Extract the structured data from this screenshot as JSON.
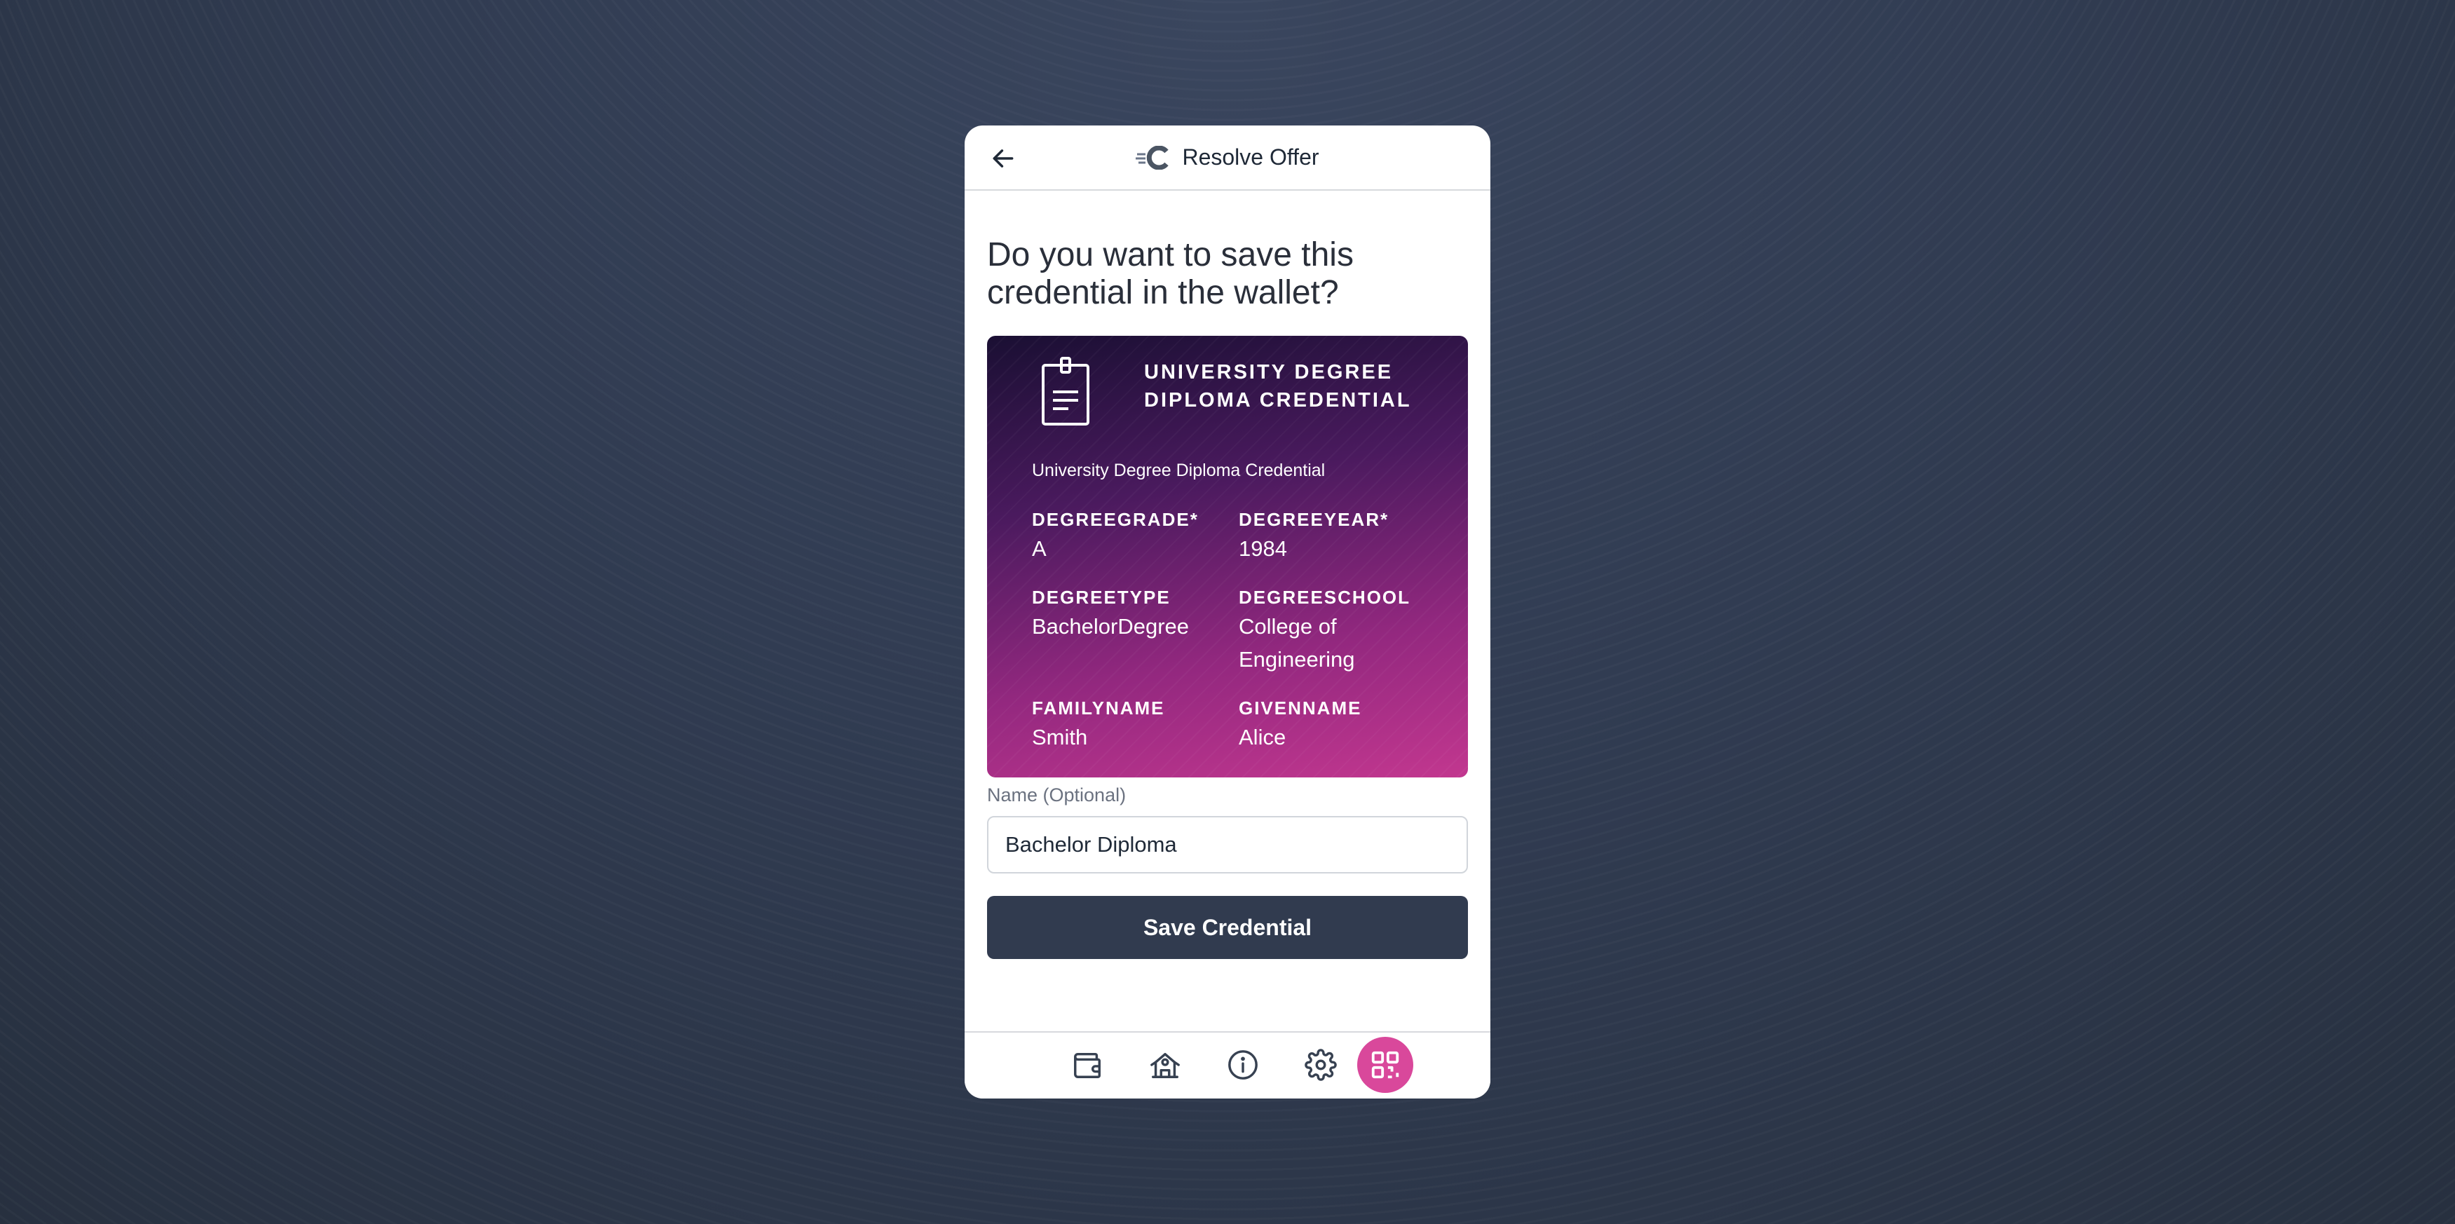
{
  "header": {
    "title": "Resolve Offer",
    "back_icon": "arrow-left-icon",
    "logo_icon": "brand-c-logo-icon"
  },
  "main": {
    "question": "Do you want to save this credential in the wallet?"
  },
  "credential_card": {
    "icon": "clipboard-document-icon",
    "title": "UNIVERSITY DEGREE DIPLOMA CREDENTIAL",
    "subtitle": "University Degree Diploma Credential",
    "fields": [
      {
        "label": "DEGREEGRADE*",
        "value": "A"
      },
      {
        "label": "DEGREEYEAR*",
        "value": "1984"
      },
      {
        "label": "DEGREETYPE",
        "value": "BachelorDegree"
      },
      {
        "label": "DEGREESCHOOL",
        "value": "College of Engineering"
      },
      {
        "label": "FAMILYNAME",
        "value": "Smith"
      },
      {
        "label": "GIVENNAME",
        "value": "Alice"
      }
    ],
    "gradient_colors": [
      "#1a0f33",
      "#c2378f"
    ]
  },
  "form": {
    "name_label": "Name (Optional)",
    "name_value": "Bachelor Diploma",
    "save_label": "Save Credential"
  },
  "bottom_nav": {
    "items": [
      {
        "icon": "wallet-icon",
        "active": false
      },
      {
        "icon": "institution-icon",
        "active": false
      },
      {
        "icon": "info-icon",
        "active": false
      },
      {
        "icon": "gear-icon",
        "active": false
      },
      {
        "icon": "qr-code-icon",
        "active": true
      }
    ],
    "active_color": "#d9489b"
  },
  "colors": {
    "background": "#2f3a50",
    "primary_button": "#313b4f",
    "accent": "#d9489b"
  }
}
